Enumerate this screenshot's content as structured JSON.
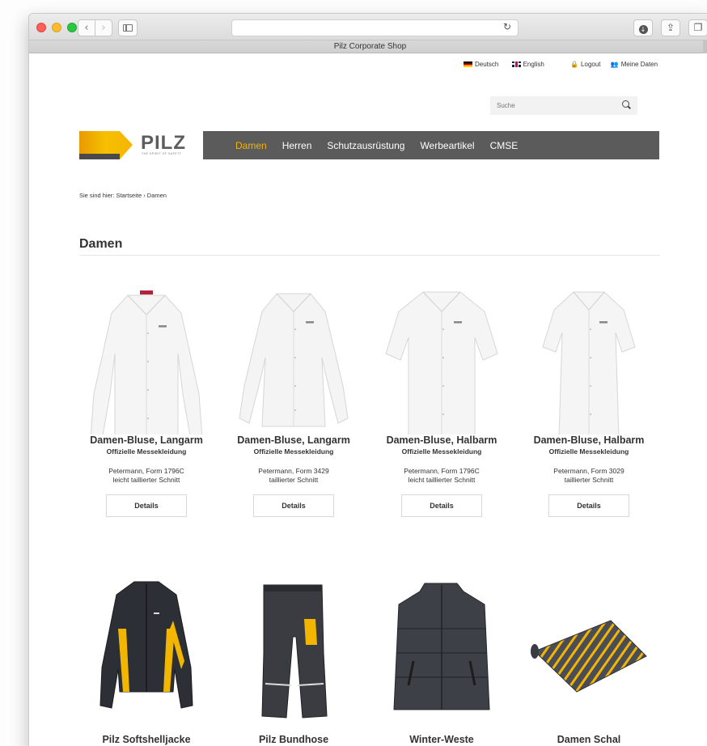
{
  "browser": {
    "tab_title": "Pilz Corporate Shop",
    "nav_back_icon": "chevron-left-icon",
    "nav_forward_icon": "chevron-right-icon"
  },
  "topbar": {
    "lang_de": "Deutsch",
    "lang_en": "English",
    "logout": "Logout",
    "my_data": "Meine Daten"
  },
  "search": {
    "placeholder": "Suche"
  },
  "logo": {
    "text": "PILZ",
    "tagline": "THE SPIRIT OF SAFETY"
  },
  "nav": {
    "items": [
      "Damen",
      "Herren",
      "Schutzausrüstung",
      "Werbeartikel",
      "CMSE"
    ],
    "active": "Damen"
  },
  "breadcrumb": "Sie sind hier: Startseite › Damen",
  "page_title": "Damen",
  "products": [
    {
      "name": "Damen-Bluse, Langarm",
      "subtitle": "Offizielle Messekleidung",
      "desc1": "Petermann, Form 1796C",
      "desc2": "leicht taillierter Schnitt",
      "button": "Details"
    },
    {
      "name": "Damen-Bluse, Langarm",
      "subtitle": "Offizielle Messekleidung",
      "desc1": "Petermann, Form 3429",
      "desc2": "taillierter Schnitt",
      "button": "Details"
    },
    {
      "name": "Damen-Bluse, Halbarm",
      "subtitle": "Offizielle Messekleidung",
      "desc1": "Petermann, Form 1796C",
      "desc2": "leicht taillierter Schnitt",
      "button": "Details"
    },
    {
      "name": "Damen-Bluse, Halbarm",
      "subtitle": "Offizielle Messekleidung",
      "desc1": "Petermann, Form 3029",
      "desc2": "taillierter Schnitt",
      "button": "Details"
    },
    {
      "name": "Pilz Softshelljacke"
    },
    {
      "name": "Pilz Bundhose"
    },
    {
      "name": "Winter-Weste"
    },
    {
      "name": "Damen Schal"
    }
  ],
  "colors": {
    "accent": "#f5b400",
    "nav_bg": "#5b5b5b",
    "logo_gray": "#5d5d5d"
  }
}
